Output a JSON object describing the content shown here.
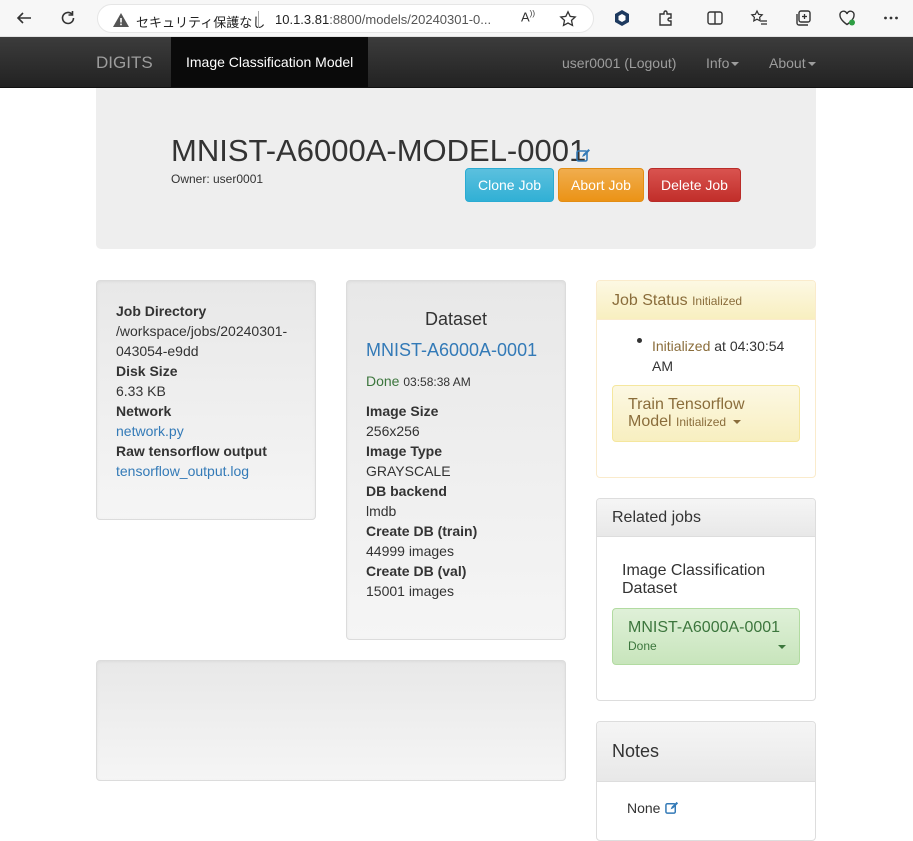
{
  "browser": {
    "security_warning": "セキュリティ保護なし",
    "url_host": "10.1.3.81",
    "url_path": ":8800/models/20240301-0...",
    "read_aloud": "A̅"
  },
  "navbar": {
    "brand": "DIGITS",
    "active": "Image Classification Model",
    "user": "user0001 (Logout)",
    "info": "Info",
    "about": "About"
  },
  "job": {
    "title": "MNIST-A6000A-MODEL-0001",
    "owner": "Owner: user0001",
    "clone": "Clone Job",
    "abort": "Abort Job",
    "delete": "Delete Job"
  },
  "info": {
    "job_dir_label": "Job Directory",
    "job_dir_1": "/workspace/jobs/20240301-",
    "job_dir_2": "043054-e9dd",
    "disk_label": "Disk Size",
    "disk_value": "6.33 KB",
    "network_label": "Network",
    "network_link": "network.py",
    "raw_label": "Raw tensorflow output",
    "raw_link": "tensorflow_output.log"
  },
  "dataset": {
    "heading": "Dataset",
    "name": "MNIST-A6000A-0001",
    "status": "Done",
    "status_time": "03:58:38 AM",
    "image_size_label": "Image Size",
    "image_size": "256x256",
    "image_type_label": "Image Type",
    "image_type": "GRAYSCALE",
    "db_backend_label": "DB backend",
    "db_backend": "lmdb",
    "train_label": "Create DB (train)",
    "train_value": "44999 images",
    "val_label": "Create DB (val)",
    "val_value": "15001 images"
  },
  "job_status": {
    "title": "Job Status",
    "state": "Initialized",
    "event_state": "Initialized",
    "event_at": "at 04:30:54",
    "event_ampm": "AM",
    "task_line1": "Train Tensorflow",
    "task_line2": "Model",
    "task_state": "Initialized"
  },
  "related": {
    "title": "Related jobs",
    "type": "Image Classification Dataset",
    "name": "MNIST-A6000A-0001",
    "status": "Done"
  },
  "notes": {
    "title": "Notes",
    "value": "None"
  },
  "colors": {
    "navbar": "#222222",
    "link": "#337ab7",
    "info_btn": "#5bc0de",
    "warning_btn": "#f0ad4e",
    "danger_btn": "#d9534f",
    "success_text": "#3c763d",
    "warning_text": "#8a6d3b"
  }
}
